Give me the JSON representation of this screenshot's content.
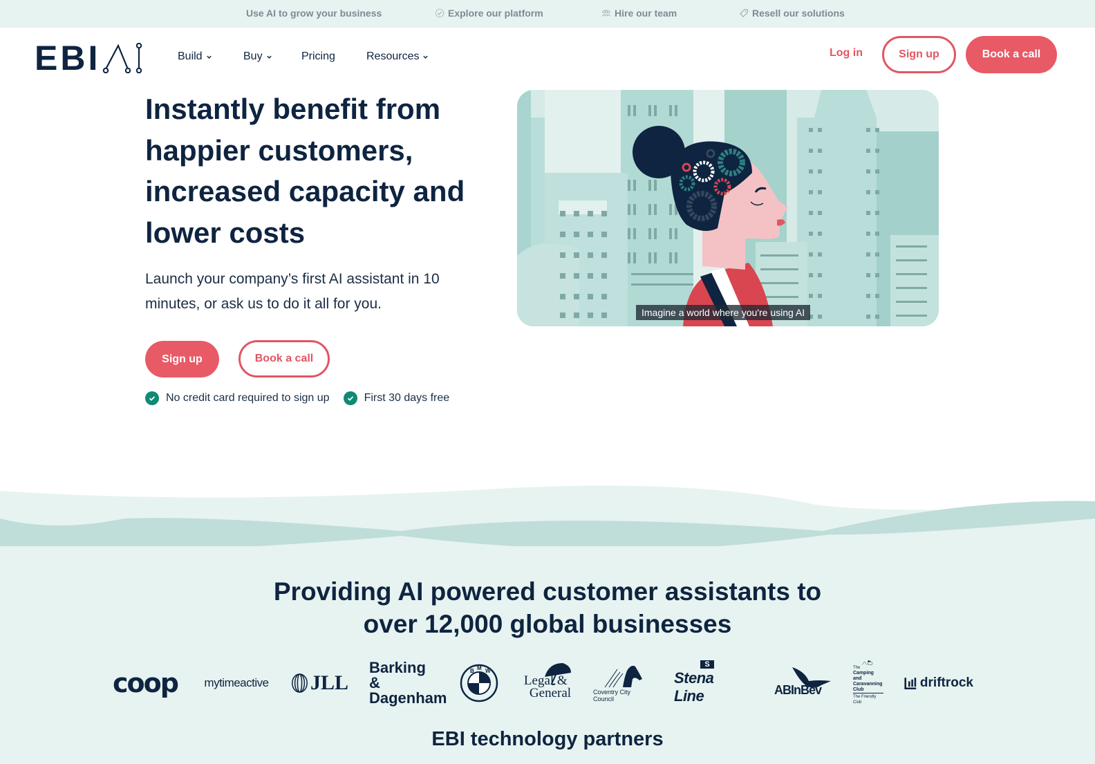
{
  "topbar": {
    "items": [
      {
        "label": "Use AI to grow your business",
        "icon": "none"
      },
      {
        "label": "Explore our platform",
        "icon": "badge-check-icon"
      },
      {
        "label": "Hire our team",
        "icon": "people-icon"
      },
      {
        "label": "Resell our solutions",
        "icon": "tag-icon"
      }
    ]
  },
  "nav": {
    "logo_text": "EBI",
    "logo_suffix": "AI",
    "menu": [
      {
        "label": "Build",
        "has_dropdown": true
      },
      {
        "label": "Buy",
        "has_dropdown": true
      },
      {
        "label": "Pricing",
        "has_dropdown": false
      },
      {
        "label": "Resources",
        "has_dropdown": true
      }
    ],
    "login_label": "Log in",
    "signup_label": "Sign up",
    "book_call_label": "Book a call"
  },
  "hero": {
    "title": "Instantly benefit from happier customers, increased capacity and lower costs",
    "subtitle": "Launch your company’s first AI assistant in 10 minutes, or ask us to do it all for you.",
    "signup_label": "Sign up",
    "book_call_label": "Book a call",
    "checks": [
      "No credit card required to sign up",
      "First 30 days free"
    ],
    "video_caption": "Imagine a world where you're using AI"
  },
  "clients": {
    "title": "Providing AI powered customer assistants to over 12,000 global businesses",
    "logos": [
      "coop",
      "mytimeactive",
      "JLL",
      "Barking & Dagenham",
      "BMW",
      "Legal & General",
      "Coventry City Council",
      "Stena Line",
      "ABInBev",
      "The Camping and Caravanning Club",
      "driftrock"
    ],
    "barking_line1": "Barking &",
    "barking_line2": "Dagenham",
    "legal_line1": "Legal &",
    "legal_line2": "General",
    "coventry": "Coventry City Council",
    "camping_line1": "The",
    "camping_line2": "Camping and",
    "camping_line3": "Caravanning",
    "camping_line4": "Club",
    "camping_line5": "The Friendly Club"
  },
  "partners": {
    "title": "EBI technology partners"
  },
  "colors": {
    "brand_navy": "#0e2440",
    "accent_coral": "#e85a66",
    "check_green": "#0f8a73",
    "mint_bg": "#e7f3f1",
    "wave_teal": "#bfddd9"
  }
}
